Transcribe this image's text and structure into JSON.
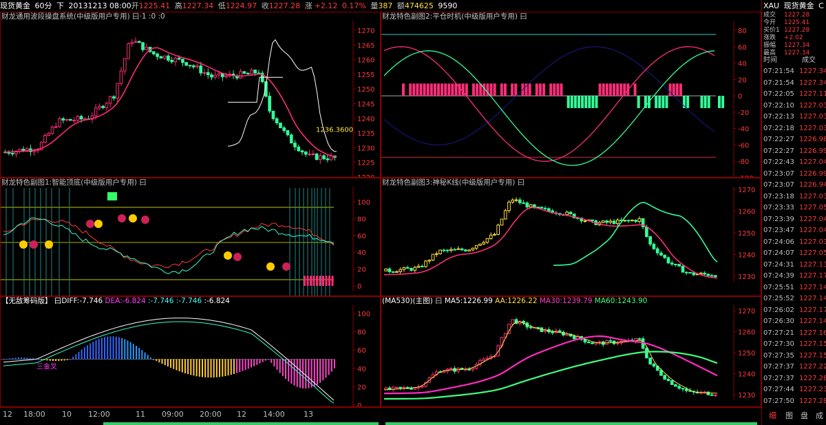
{
  "topbar": {
    "name": "现货黄金",
    "period": "60分",
    "dir": "下",
    "datetime": "20131213 08:00",
    "open_label": "开",
    "open": "1225.41",
    "high_label": "高",
    "high": "1227.34",
    "low_label": "低",
    "low": "1224.97",
    "close_label": "收",
    "close": "1227.28",
    "chg_label": "涨",
    "chg": "+2.12",
    "chg_pct": "0.17%",
    "vol_label": "量",
    "vol": "387",
    "amt_label": "额",
    "amt": "474625",
    "extra": "9590"
  },
  "panels": {
    "main": {
      "title": "财龙通用波段操盘系统(中级版用户专用)",
      "icons": "曰·1 :0 :0",
      "price_label": "1236.3600",
      "yaxis": [
        "1270",
        "1265",
        "1260",
        "1255",
        "1250",
        "1245",
        "1240",
        "1235",
        "1230",
        "1225",
        "1220"
      ]
    },
    "sub1": {
      "title": "财龙特色副图1:智能顶底(中级版用户专用)",
      "icons": "曰",
      "yaxis": [
        "100",
        "80",
        "60",
        "40",
        "20",
        "0"
      ]
    },
    "sub2": {
      "title": "【无敌筹码版】",
      "diff_label": "曰DIFF:",
      "diff": "-7.746",
      "dea_label": "DEA:",
      "dea": "-6.824",
      "v3": ":-7.746",
      "v4": ":-7.746",
      "v5": ":-6.824",
      "note": "三金叉",
      "yaxis": [
        "100",
        "80",
        "60",
        "40",
        "20",
        "0"
      ]
    },
    "r1": {
      "title": "财龙特色副图2:平仓时机(中级版用户专用)",
      "icons": "曰",
      "yaxis": [
        "80",
        "60",
        "40",
        "20",
        "0",
        "-20",
        "-40",
        "-60",
        "-80",
        "-100"
      ]
    },
    "r2": {
      "title": "财龙特色副图3:神秘K线(中级版用户专用)",
      "icons": "曰",
      "yaxis": [
        "1270",
        "1260",
        "1250",
        "1240",
        "1230"
      ]
    },
    "r3": {
      "title": "(MA530)(主图)",
      "icons": "曰",
      "ma5_label": "MA5:",
      "ma5": "1226.99",
      "aa_label": "AA:",
      "aa": "1226.22",
      "ma30_label": "MA30:",
      "ma30": "1239.79",
      "ma60_label": "MA60:",
      "ma60": "1243.90",
      "yaxis": [
        "1270",
        "1260",
        "1250",
        "1240",
        "1230"
      ]
    }
  },
  "xaxis": [
    "12",
    "18:00",
    "10",
    "12:00",
    "11",
    "09:00",
    "20:00",
    "12",
    "14:00",
    "13"
  ],
  "right": {
    "symbol": "XAU",
    "name": "现货黄金",
    "extra": "C",
    "quotes": [
      {
        "label": "成交",
        "value": "1227.28"
      },
      {
        "label": "今开",
        "value": "1225.41"
      },
      {
        "label": "买价1",
        "value": "1227.28"
      },
      {
        "label": "涨跌",
        "value": "+2.02"
      },
      {
        "label": "振幅",
        "value": "1227.34"
      },
      {
        "label": "最高",
        "value": "1227.34"
      }
    ],
    "col_time": "时间",
    "col_price": "成交",
    "ticks": [
      {
        "t": "07:21:54",
        "p": "1227.34"
      },
      {
        "t": "07:21:54",
        "p": "1227.34"
      },
      {
        "t": "07:22:05",
        "p": "1227.11"
      },
      {
        "t": "07:22:10",
        "p": "1227.03"
      },
      {
        "t": "07:22:13",
        "p": "1227.03"
      },
      {
        "t": "07:22:18",
        "p": "1227.03"
      },
      {
        "t": "07:22:27",
        "p": "1226.98"
      },
      {
        "t": "07:22:27",
        "p": "1226.99"
      },
      {
        "t": "07:22:43",
        "p": "1227.04"
      },
      {
        "t": "07:23:07",
        "p": "1226.99"
      },
      {
        "t": "07:23:07",
        "p": "1226.94"
      },
      {
        "t": "07:23:18",
        "p": "1227.03"
      },
      {
        "t": "07:23:33",
        "p": "1227.05"
      },
      {
        "t": "07:23:39",
        "p": "1227.04"
      },
      {
        "t": "07:23:47",
        "p": "1227.04"
      },
      {
        "t": "07:24:06",
        "p": "1227.03"
      },
      {
        "t": "07:24:07",
        "p": "1227.05"
      },
      {
        "t": "07:24:31",
        "p": "1227.13"
      },
      {
        "t": "07:24:39",
        "p": "1227.17"
      },
      {
        "t": "07:25:51",
        "p": "1227.14"
      },
      {
        "t": "07:25:52",
        "p": "1227.14"
      },
      {
        "t": "07:26:02",
        "p": "1227.17"
      },
      {
        "t": "07:26:30",
        "p": "1227.14"
      },
      {
        "t": "07:27:21",
        "p": "1227.16"
      },
      {
        "t": "07:27:30",
        "p": "1227.15"
      },
      {
        "t": "07:27:35",
        "p": "1227.15"
      },
      {
        "t": "07:27:37",
        "p": "1227.22"
      },
      {
        "t": "07:27:37",
        "p": "1227.28"
      },
      {
        "t": "07:27:44",
        "p": "1227.23"
      },
      {
        "t": "07:27:50",
        "p": "1227.28"
      }
    ],
    "tabs": [
      "细",
      "图",
      "盘",
      "成"
    ]
  },
  "colors": {
    "red": "#ff3b3b",
    "border": "#8b0000",
    "green": "#33ff99",
    "pink": "#ff2d78",
    "yellow": "#ffe040",
    "navy": "#1a1a8c"
  }
}
